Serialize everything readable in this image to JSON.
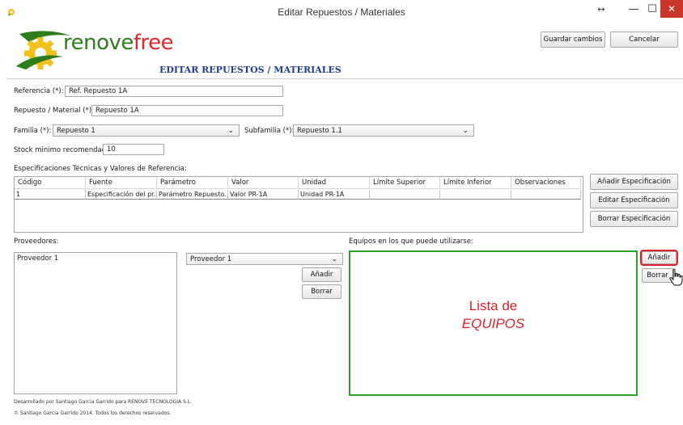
{
  "window": {
    "title": "Editar Repuestos / Materiales",
    "resize_icon": "resize-arrows-icon",
    "min_icon": "minimize-icon",
    "max_icon": "maximize-icon",
    "close_icon": "close-icon"
  },
  "header": {
    "logo_text_main": "renove",
    "logo_text_accent": "free",
    "heading": "EDITAR REPUESTOS / MATERIALES",
    "save_label": "Guardar cambios",
    "cancel_label": "Cancelar"
  },
  "form": {
    "referencia_label": "Referencia (*):",
    "referencia_value": "Ref. Repuesto 1A",
    "repuesto_label": "Repuesto / Material (*):",
    "repuesto_value": "Repuesto 1A",
    "familia_label": "Familia (*):",
    "familia_value": "Repuesto 1",
    "subfamilia_label": "Subfamilia (*):",
    "subfamilia_value": "Repuesto 1.1",
    "stock_label": "Stock minimo recomendado:",
    "stock_value": "10"
  },
  "specs": {
    "section_label": "Especificaciones Técnicas y Valores de Referencia:",
    "columns": [
      "Código",
      "Fuente",
      "Parámetro",
      "Valor",
      "Unidad",
      "Límite Superior",
      "Límite Inferior",
      "Observaciones"
    ],
    "rows": [
      [
        "1",
        "Especificación del pr...",
        "Parámetro Repuesto...",
        "Valor PR-1A",
        "Unidad PR-1A",
        "",
        "",
        ""
      ]
    ],
    "add_label": "Añadir Especificación",
    "edit_label": "Editar Especificación",
    "delete_label": "Borrar Especificación"
  },
  "proveedores": {
    "section_label": "Proveedores:",
    "items": [
      "Proveedor 1"
    ],
    "selected": "Proveedor 1",
    "add_label": "Añadir",
    "delete_label": "Borrar"
  },
  "equipos": {
    "section_label": "Equipos en los que puede utilizarse:",
    "placeholder_line1": "Lista de",
    "placeholder_line2": "EQUIPOS",
    "add_label": "Añadir",
    "delete_label": "Borrar",
    "highlight_color": "#2aa12a",
    "emphasis_color": "#e0202a"
  },
  "footer": {
    "line1": "Desarrollado por Santiago Garcia Garrido para RENOVE TECNOLOGIA S.L.",
    "line2": "© Santiago Garcia Garrido 2014. Todos los derechos reservados."
  },
  "colors": {
    "logo_green": "#2e7d1d",
    "logo_red": "#e0282c",
    "logo_gear_yellow": "#f2c21a",
    "heading_blue": "#1f3d8c",
    "close_red": "#c9352b"
  }
}
